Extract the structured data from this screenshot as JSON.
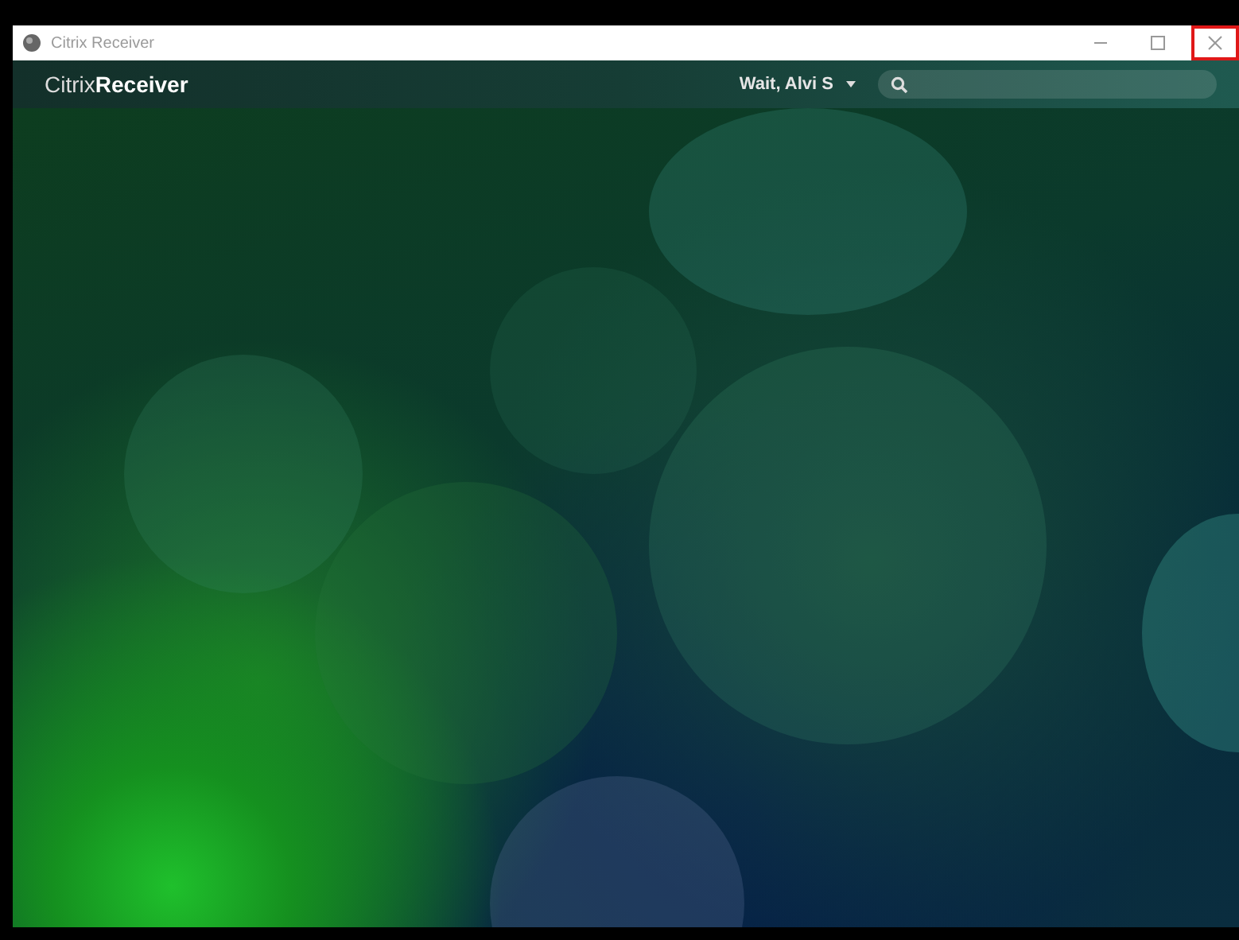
{
  "window": {
    "title": "Citrix Receiver",
    "close_highlighted": true
  },
  "header": {
    "brand_light": "Citrix",
    "brand_bold": "Receiver",
    "user": "Wait, Alvi S"
  }
}
